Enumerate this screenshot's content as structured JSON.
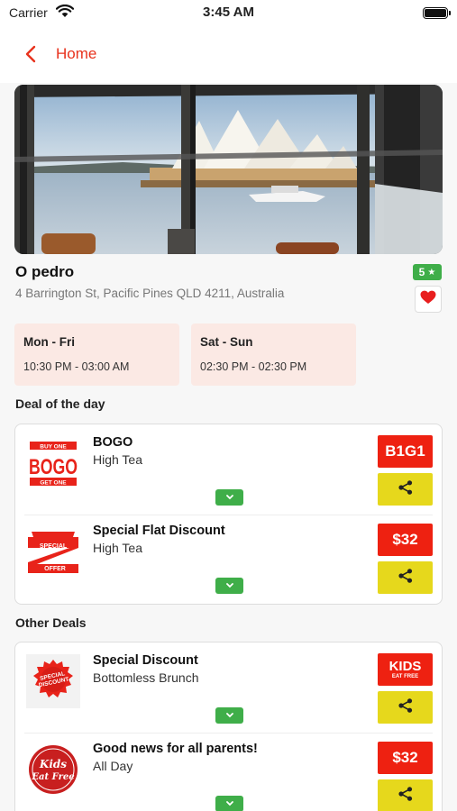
{
  "status_bar": {
    "carrier": "Carrier",
    "time": "3:45 AM"
  },
  "nav": {
    "back_label": "Home"
  },
  "venue": {
    "name": "O pedro",
    "address": "4 Barrington St, Pacific Pines QLD 4211, Australia",
    "rating": "5",
    "rating_star": "★"
  },
  "hours": [
    {
      "days": "Mon - Fri",
      "time": "10:30 PM - 03:00 AM"
    },
    {
      "days": "Sat - Sun",
      "time": "02:30 PM - 02:30 PM"
    }
  ],
  "deal_of_the_day": {
    "title": "Deal of the day",
    "items": [
      {
        "title": "BOGO",
        "subtitle": "High Tea",
        "tag": "B1G1",
        "thumb_top": "BUY ONE",
        "thumb_main": "BOGO",
        "thumb_bottom": "GET ONE"
      },
      {
        "title": "Special Flat Discount",
        "subtitle": "High Tea",
        "tag": "$32",
        "thumb_top": "SPECIAL",
        "thumb_bottom": "OFFER"
      }
    ]
  },
  "other_deals": {
    "title": "Other Deals",
    "items": [
      {
        "title": "Special Discount",
        "subtitle": "Bottomless Brunch",
        "tag_main": "KIDS",
        "tag_sub": "EAT FREE",
        "thumb_line1": "SPECIAL",
        "thumb_line2": "DISCOUNT"
      },
      {
        "title": "Good news for all parents!",
        "subtitle": "All Day",
        "tag": "$32",
        "thumb_line1": "Kids",
        "thumb_line2": "Eat Free"
      }
    ]
  },
  "colors": {
    "accent": "#e8321c",
    "tag_red": "#ee2111",
    "share_yellow": "#e6d81c",
    "green": "#3fae49",
    "hours_bg": "#fbe9e4"
  },
  "icons": {
    "back": "chevron-left-icon",
    "wifi": "wifi-icon",
    "battery": "battery-icon",
    "favorite": "heart-icon",
    "share": "share-icon",
    "expand": "chevron-down-icon"
  }
}
